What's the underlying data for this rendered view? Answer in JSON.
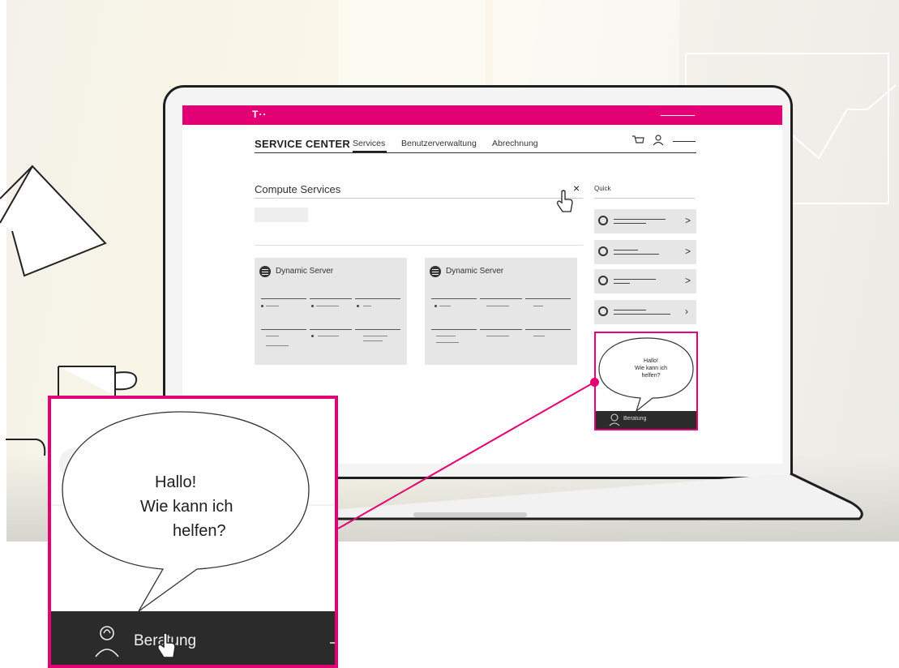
{
  "colors": {
    "brand": "#e20074",
    "chat_bar": "#2b2b2b",
    "text": "#222222"
  },
  "header": {
    "logo": "T··",
    "brand": "SERVICE CENTER",
    "nav": [
      "Services",
      "Benutzerverwaltung",
      "Abrechnung"
    ],
    "active_nav": "Services",
    "icons": [
      "cart-icon",
      "user-icon"
    ]
  },
  "main": {
    "section_title": "Compute Services",
    "close_label": "×",
    "cards": [
      {
        "title": "Dynamic Server",
        "icon": "list-icon"
      },
      {
        "title": "Dynamic Server",
        "icon": "list-icon"
      }
    ]
  },
  "quick": {
    "label": "Quick",
    "items": [
      {
        "icon": "globe-icon",
        "chevron": ">"
      },
      {
        "icon": "shield-icon",
        "chevron": ">"
      },
      {
        "icon": "list-icon",
        "chevron": ">"
      },
      {
        "icon": "gear-icon",
        "chevron": "›"
      }
    ]
  },
  "chat": {
    "greeting_line1": "Hallo!",
    "greeting_line2": "Wie kann ich",
    "greeting_line3": "helfen?",
    "button_label": "Beratung"
  }
}
